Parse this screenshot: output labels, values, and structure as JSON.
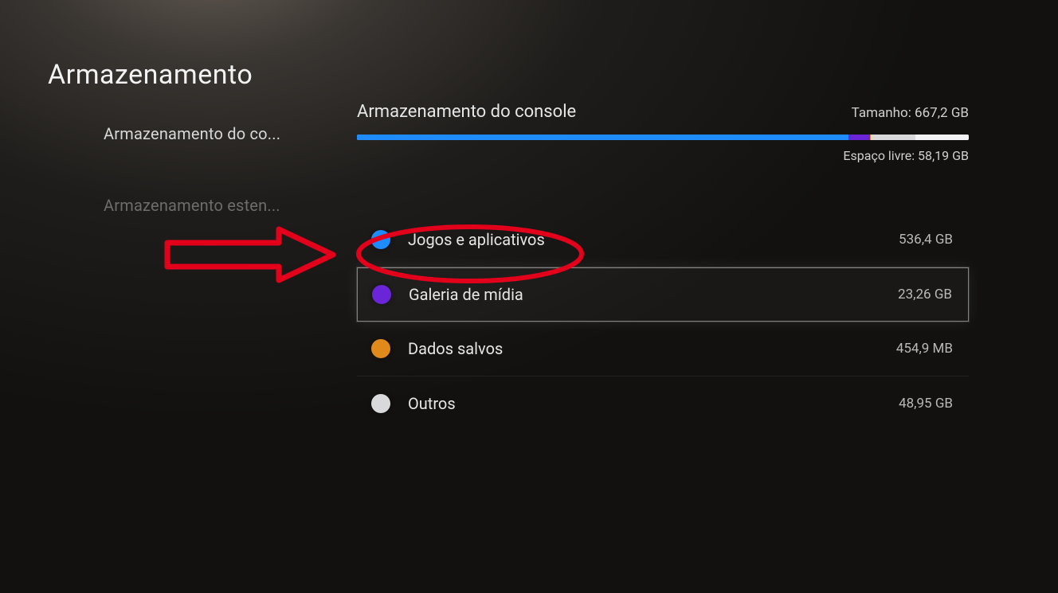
{
  "page_title": "Armazenamento",
  "sidebar": {
    "items": [
      {
        "label": "Armazenamento do co...",
        "active": true
      },
      {
        "label": "Armazenamento esten...",
        "active": false
      }
    ]
  },
  "storage": {
    "title": "Armazenamento do console",
    "size_label": "Tamanho: 667,2 GB",
    "free_label": "Espaço livre: 58,19 GB",
    "bar_segments": [
      {
        "color": "#1e8cff",
        "pct": 80.4
      },
      {
        "color": "#6a25d8",
        "pct": 3.5
      },
      {
        "color": "#e08a1b",
        "pct": 0.07
      },
      {
        "color": "#d9d9db",
        "pct": 7.33
      },
      {
        "color": "#f3f3f5",
        "pct": 8.7
      }
    ]
  },
  "categories": [
    {
      "label": "Jogos e aplicativos",
      "size": "536,4 GB",
      "color": "#1e8cff",
      "selected": false
    },
    {
      "label": "Galeria de mídia",
      "size": "23,26 GB",
      "color": "#6a25d8",
      "selected": true
    },
    {
      "label": "Dados salvos",
      "size": "454,9 MB",
      "color": "#e08a1b",
      "selected": false
    },
    {
      "label": "Outros",
      "size": "48,95 GB",
      "color": "#d9d9db",
      "selected": false
    }
  ],
  "annotation": {
    "arrow_color": "#e3001b",
    "ellipse_color": "#e3001b"
  }
}
